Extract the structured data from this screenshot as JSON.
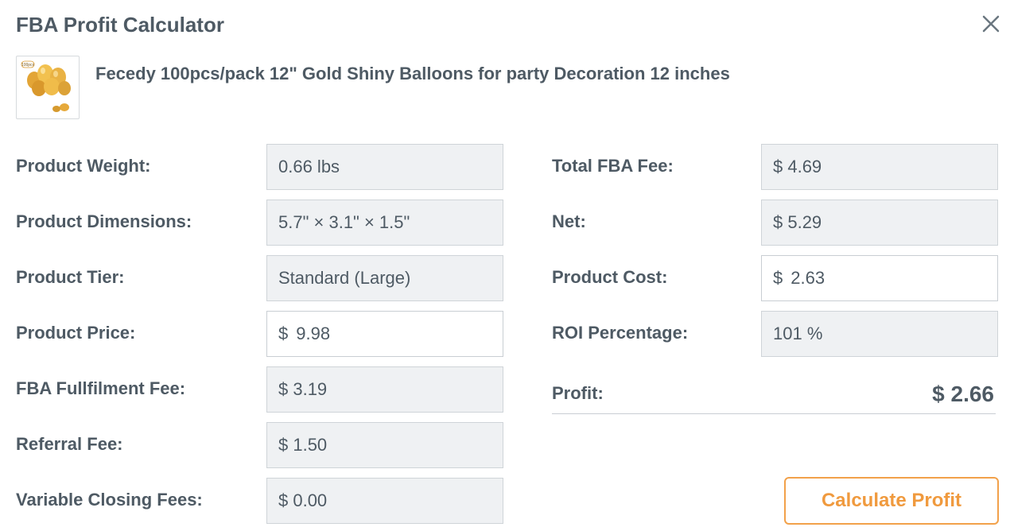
{
  "dialog": {
    "title": "FBA Profit Calculator",
    "close_icon": "close-icon"
  },
  "product": {
    "name": "Fecedy 100pcs/pack 12\" Gold Shiny Balloons for party Decoration 12 inches",
    "image_badge": "100pcs",
    "image_icon": "gold-balloons-product-image"
  },
  "left_fields": {
    "weight": {
      "label": "Product Weight:",
      "value": "0.66 lbs"
    },
    "dimensions": {
      "label": "Product Dimensions:",
      "value": "5.7\" × 3.1\" × 1.5\""
    },
    "tier": {
      "label": "Product Tier:",
      "value": "Standard (Large)"
    },
    "price": {
      "label": "Product Price:",
      "currency": "$",
      "value": "9.98"
    },
    "fulfilment_fee": {
      "label": "FBA Fullfilment Fee:",
      "value": "$ 3.19"
    },
    "referral_fee": {
      "label": "Referral Fee:",
      "value": "$ 1.50"
    },
    "closing_fees": {
      "label": "Variable Closing Fees:",
      "value": "$ 0.00"
    }
  },
  "right_fields": {
    "total_fee": {
      "label": "Total FBA Fee:",
      "value": "$ 4.69"
    },
    "net": {
      "label": "Net:",
      "value": "$ 5.29"
    },
    "cost": {
      "label": "Product Cost:",
      "currency": "$",
      "value": "2.63"
    },
    "roi": {
      "label": "ROI Percentage:",
      "value": "101 %"
    }
  },
  "profit": {
    "label": "Profit:",
    "value": "$ 2.66"
  },
  "actions": {
    "calculate_label": "Calculate Profit"
  },
  "colors": {
    "text": "#4e5a64",
    "readonly_bg": "#eff1f3",
    "border": "#cfd4d8",
    "accent": "#f09a3e"
  }
}
